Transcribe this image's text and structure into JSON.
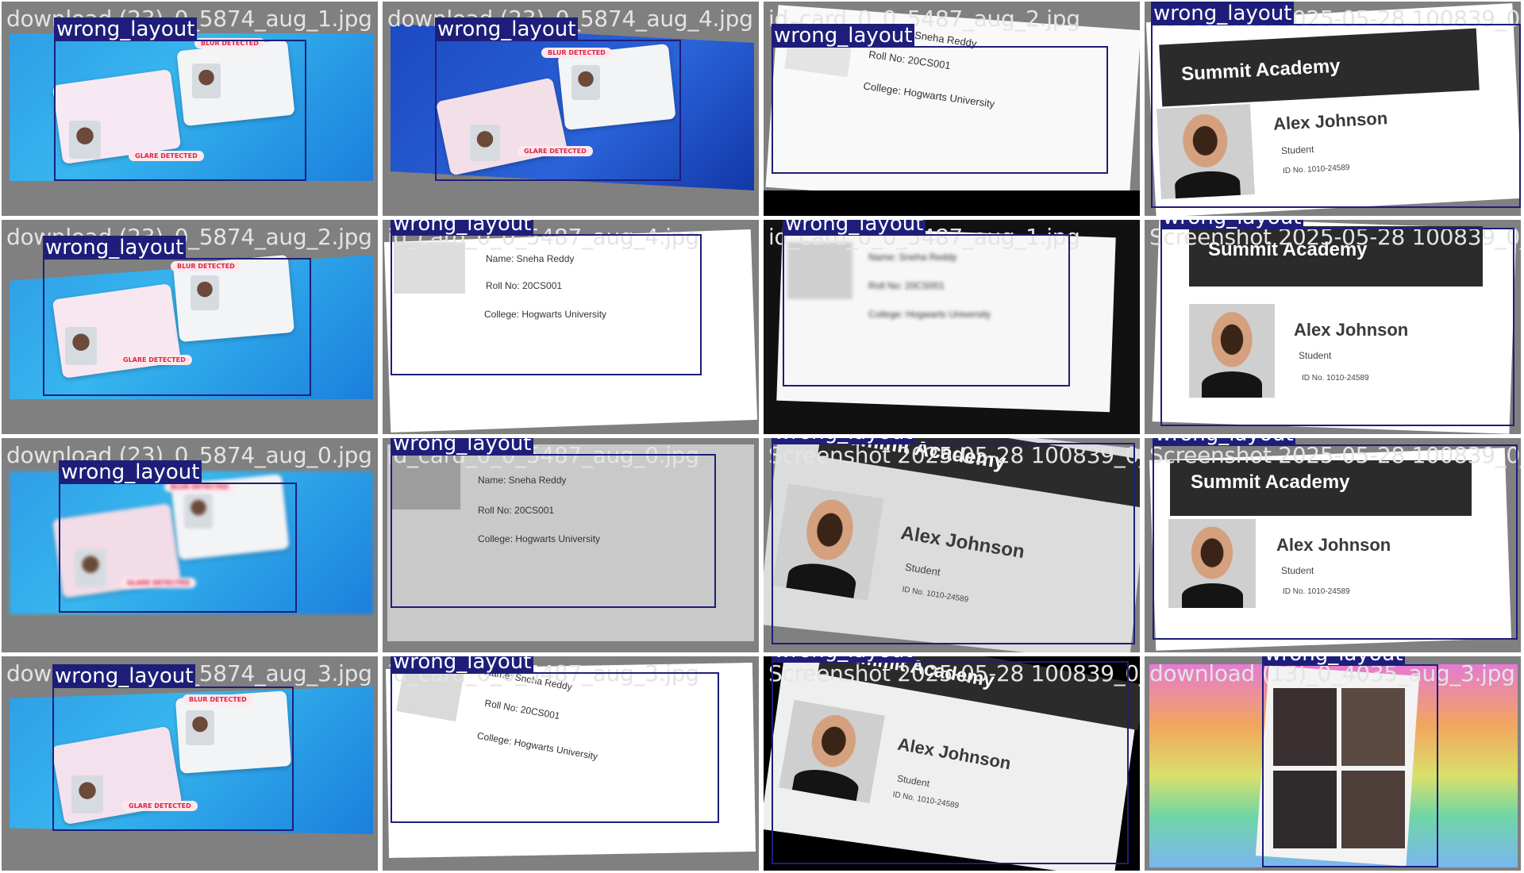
{
  "tiles": [
    {
      "filename": "download (23)_0_5874_aug_1.jpg",
      "label": "wrong_layout"
    },
    {
      "filename": "download (23)_0_5874_aug_4.jpg",
      "label": "wrong_layout"
    },
    {
      "filename": "id_card_0_0_5487_aug_2.jpg",
      "label": "wrong_layout"
    },
    {
      "filename": "Screenshot 2025-05-28 100839_0_",
      "label": "wrong_layout"
    },
    {
      "filename": "download (23)_0_5874_aug_2.jpg",
      "label": "wrong_layout"
    },
    {
      "filename": "id_card_0_0_5487_aug_4.jpg",
      "label": "wrong_layout"
    },
    {
      "filename": "id_card_0_0_5487_aug_1.jpg",
      "label": "wrong_layout"
    },
    {
      "filename": "Screenshot 2025-05-28 100839_0_",
      "label": "wrong_layout"
    },
    {
      "filename": "download (23)_0_5874_aug_0.jpg",
      "label": "wrong_layout"
    },
    {
      "filename": "id_card_0_0_5487_aug_0.jpg",
      "label": "wrong_layout"
    },
    {
      "filename": "Screenshot 2025-05-28 100839_0_",
      "label": "wrong_layout"
    },
    {
      "filename": "Screenshot 2025-05-28 100839_0_",
      "label": "wrong_layout"
    },
    {
      "filename": "download (23)_0_5874_aug_3.jpg",
      "label": "wrong_layout"
    },
    {
      "filename": "id_card_0_0_5487_aug_3.jpg",
      "label": "wrong_layout"
    },
    {
      "filename": "Screenshot 2025-05-28 100839_0_",
      "label": "wrong_layout"
    },
    {
      "filename": "download (13)_0_4035_aug_3.jpg",
      "label": "wrong_layout"
    }
  ],
  "badges": {
    "blur": "BLUR DETECTED",
    "glare": "GLARE DETECTED"
  },
  "student_card": {
    "name": "Sneha Reddy",
    "roll": "Roll No: 20CS001",
    "college": "College: Hogwarts University",
    "name_line": "Name: Sneha Reddy"
  },
  "summit_card": {
    "school": "Summit Academy",
    "name": "Alex Johnson",
    "role": "Student",
    "id": "ID No. 1010-24589"
  },
  "colors": {
    "tile_bg": "#808080",
    "box": "#1e1e7a",
    "label_text": "#ffffff"
  }
}
